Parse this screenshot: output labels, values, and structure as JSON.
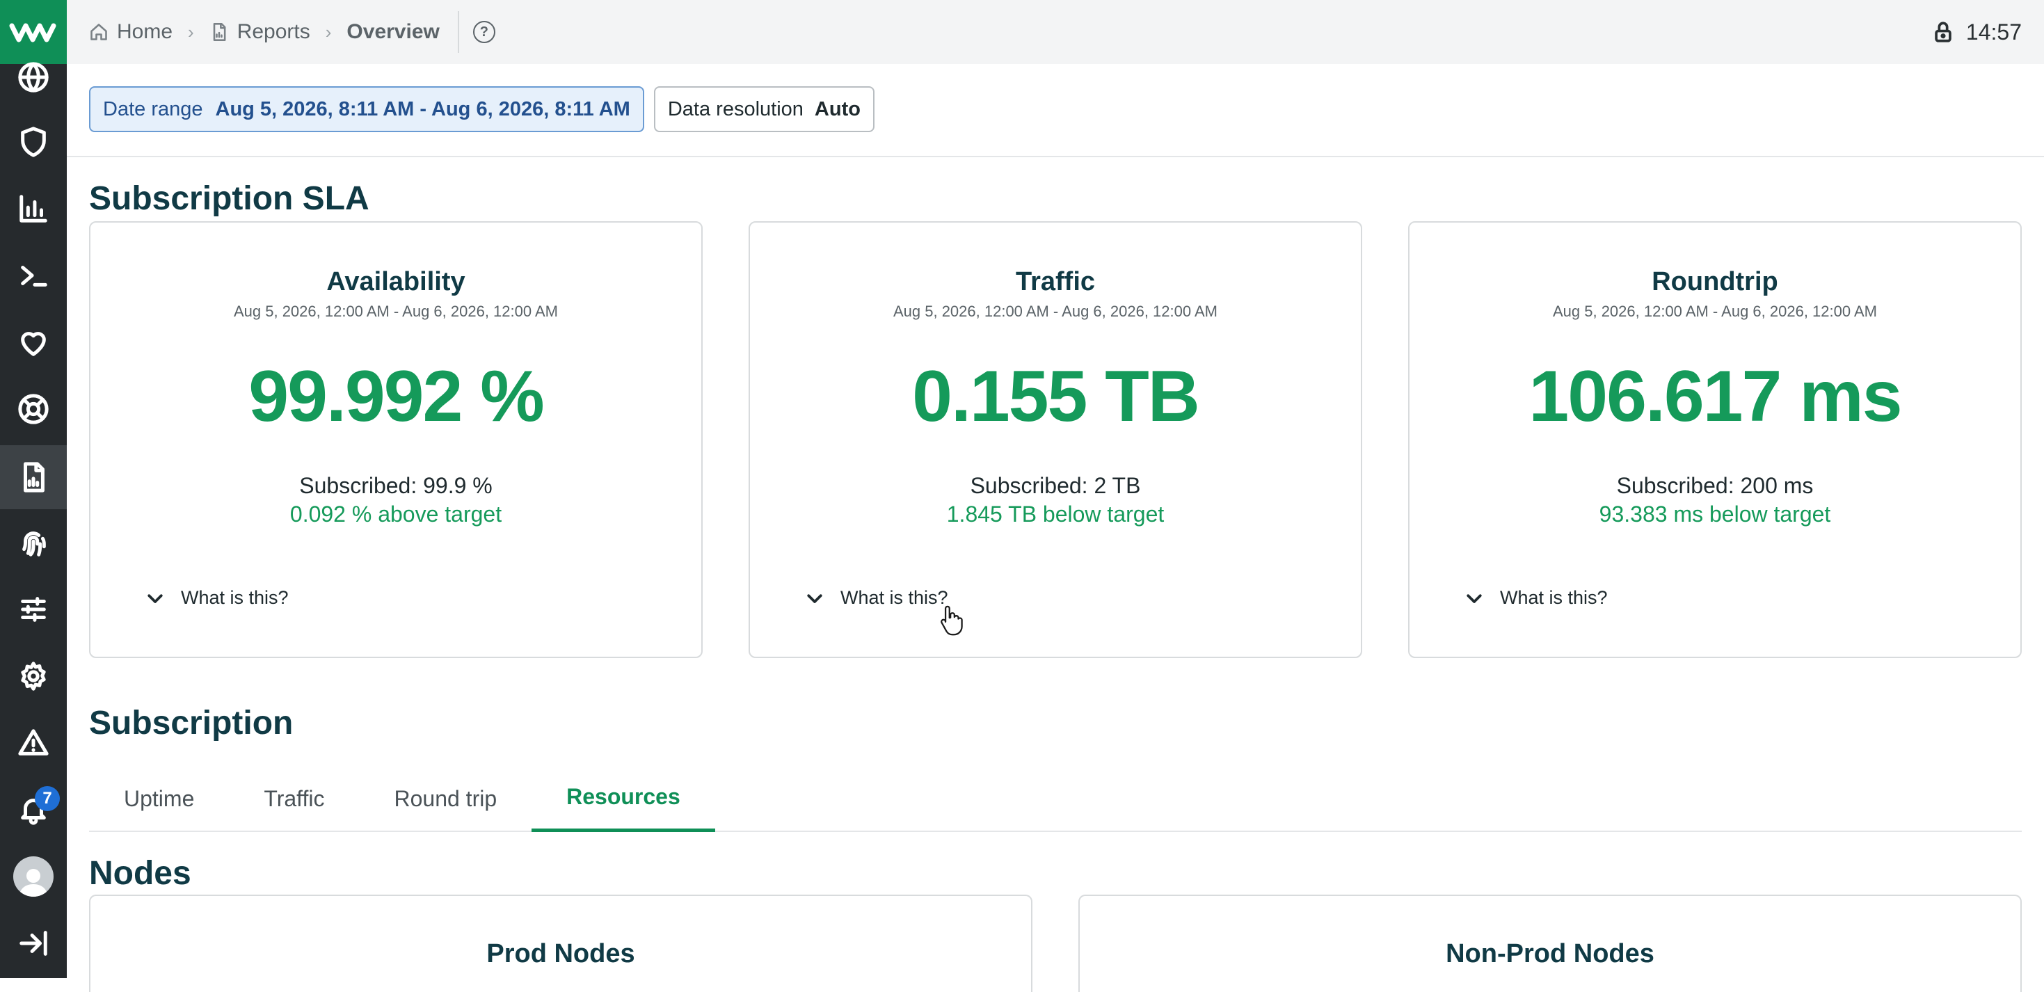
{
  "breadcrumb": {
    "home": "Home",
    "reports": "Reports",
    "current": "Overview"
  },
  "topbar": {
    "clock": "14:57"
  },
  "filters": {
    "date_label": "Date range",
    "date_value": "Aug 5, 2026, 8:11 AM - Aug 6, 2026, 8:11 AM",
    "res_label": "Data resolution",
    "res_value": "Auto"
  },
  "sidebar": {
    "notification_count": "7",
    "items": [
      "globe-icon",
      "shield-icon",
      "chart-icon",
      "terminal-icon",
      "heart-icon",
      "lifebuoy-icon",
      "report-icon",
      "fingerprint-icon",
      "sliders-icon",
      "gear-icon",
      "warning-icon",
      "bell-icon",
      "avatar",
      "collapse-icon"
    ]
  },
  "sla": {
    "title": "Subscription SLA",
    "cards": [
      {
        "title": "Availability",
        "range": "Aug 5, 2026, 12:00 AM - Aug 6, 2026, 12:00 AM",
        "value": "99.992 %",
        "subscribed": "Subscribed: 99.9 %",
        "delta": "0.092 % above target",
        "what": "What is this?"
      },
      {
        "title": "Traffic",
        "range": "Aug 5, 2026, 12:00 AM - Aug 6, 2026, 12:00 AM",
        "value": "0.155 TB",
        "subscribed": "Subscribed: 2 TB",
        "delta": "1.845 TB below target",
        "what": "What is this?"
      },
      {
        "title": "Roundtrip",
        "range": "Aug 5, 2026, 12:00 AM - Aug 6, 2026, 12:00 AM",
        "value": "106.617 ms",
        "subscribed": "Subscribed: 200 ms",
        "delta": "93.383 ms below target",
        "what": "What is this?"
      }
    ]
  },
  "subscription": {
    "title": "Subscription",
    "tabs": [
      {
        "label": "Uptime"
      },
      {
        "label": "Traffic"
      },
      {
        "label": "Round trip"
      },
      {
        "label": "Resources",
        "active": true
      }
    ]
  },
  "nodes": {
    "title": "Nodes",
    "prod_title": "Prod Nodes",
    "nonprod_title": "Non-Prod Nodes"
  },
  "colors": {
    "accent": "#0f8f57",
    "value_green": "#159a5a",
    "sidebar": "#262a2d",
    "badge": "#1f6fd6"
  }
}
